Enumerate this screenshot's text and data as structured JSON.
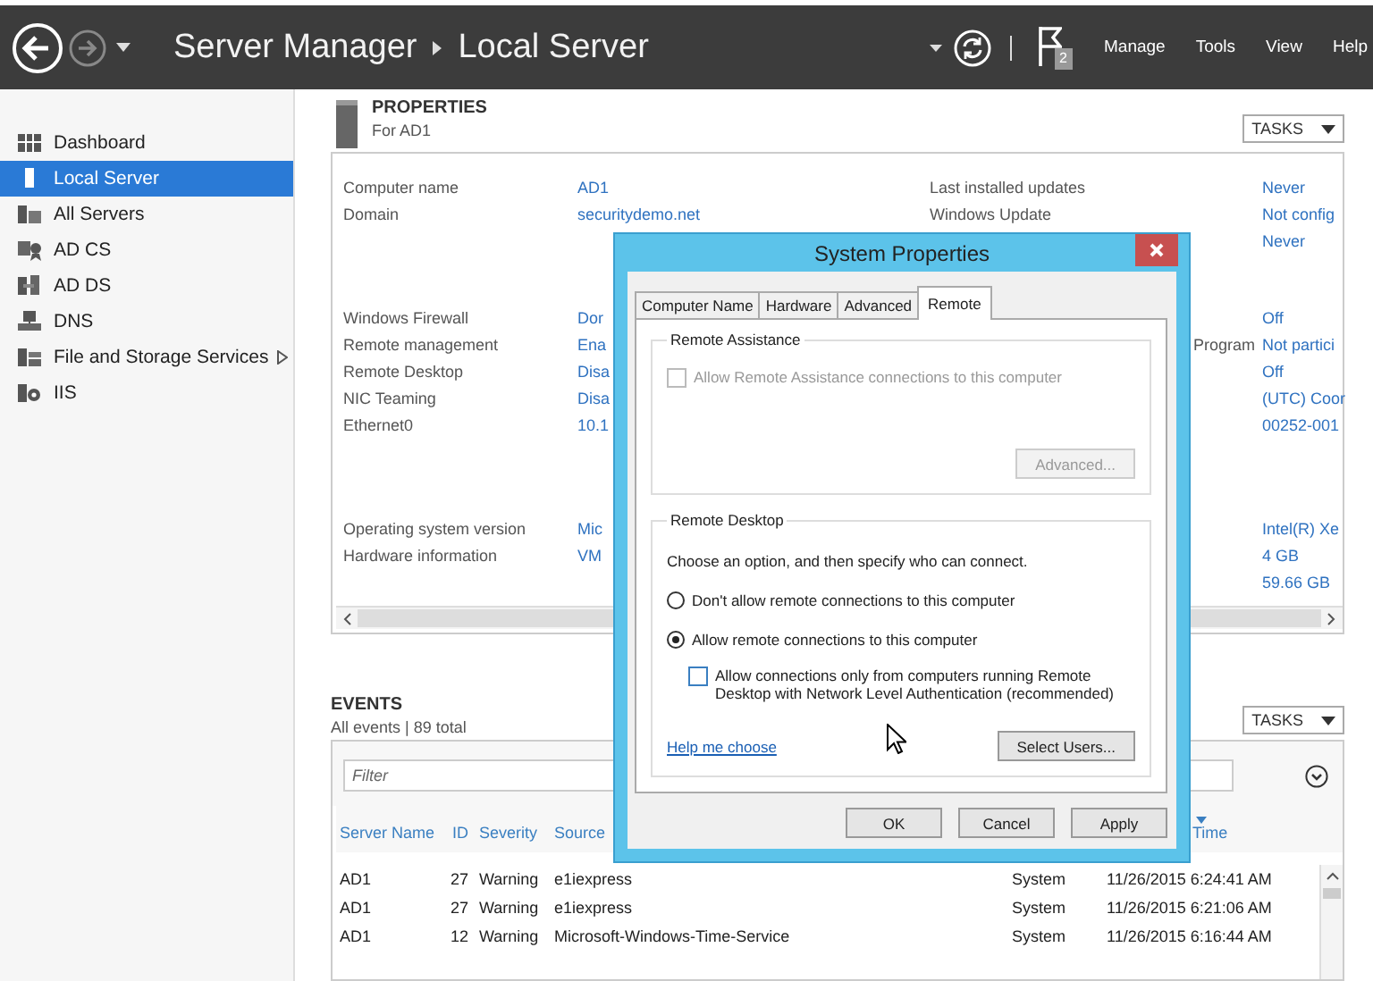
{
  "toolbar": {
    "title": "Server Manager",
    "subtitle": "Local Server",
    "notifications": "2",
    "menu": [
      "Manage",
      "Tools",
      "View",
      "Help"
    ]
  },
  "sidebar": {
    "items": [
      {
        "label": "Dashboard",
        "kind": "dashboard",
        "selected": false,
        "expandable": false
      },
      {
        "label": "Local Server",
        "kind": "server",
        "selected": true,
        "expandable": false
      },
      {
        "label": "All Servers",
        "kind": "servers",
        "selected": false,
        "expandable": false
      },
      {
        "label": "AD CS",
        "kind": "adcs",
        "selected": false,
        "expandable": false
      },
      {
        "label": "AD DS",
        "kind": "adds",
        "selected": false,
        "expandable": false
      },
      {
        "label": "DNS",
        "kind": "dns",
        "selected": false,
        "expandable": false
      },
      {
        "label": "File and Storage Services",
        "kind": "storage",
        "selected": false,
        "expandable": true
      },
      {
        "label": "IIS",
        "kind": "iis",
        "selected": false,
        "expandable": false
      }
    ]
  },
  "properties": {
    "title": "PROPERTIES",
    "subtitle": "For AD1",
    "tasks": "TASKS",
    "groups": [
      [
        {
          "label": "Computer name",
          "value": "AD1",
          "label_2": "Last installed updates",
          "value_2": "Never"
        },
        {
          "label": "Domain",
          "value": "securitydemo.net",
          "label_2": "Windows Update",
          "value_2": "Not config"
        },
        {
          "value_2": "Never"
        }
      ],
      [
        {
          "label": "Windows Firewall",
          "value": "Dor",
          "value_2": "Off"
        },
        {
          "label": "Remote management",
          "value": "Ena",
          "label_2": "Program",
          "label_2_covered": true,
          "value_2": "Not partici"
        },
        {
          "label": "Remote Desktop",
          "value": "Disa",
          "value_2": "Off"
        },
        {
          "label": "NIC Teaming",
          "value": "Disa",
          "value_2": "(UTC) Coor"
        },
        {
          "label": "Ethernet0",
          "value": "10.1",
          "value_2": "00252-001"
        }
      ],
      [
        {
          "label": "Operating system version",
          "value": "Mic",
          "value_2": "Intel(R) Xe"
        },
        {
          "label": "Hardware information",
          "value": "VM",
          "value_2": "4 GB"
        },
        {
          "value_2": "59.66 GB"
        }
      ]
    ]
  },
  "events": {
    "title": "EVENTS",
    "subtitle": "All events | 89 total",
    "tasks": "TASKS",
    "filter_placeholder": "Filter",
    "columns": [
      {
        "label": "Server Name",
        "sorted": false
      },
      {
        "label": "ID",
        "sorted": false
      },
      {
        "label": "Severity",
        "sorted": false
      },
      {
        "label": "Source",
        "sorted": false
      },
      {
        "label": "Time",
        "sorted": true
      }
    ],
    "rows": [
      {
        "server_name": "AD1",
        "id": "27",
        "severity": "Warning",
        "source": "e1iexpress",
        "column_5": "System",
        "time": "11/26/2015 6:24:41 AM"
      },
      {
        "server_name": "AD1",
        "id": "27",
        "severity": "Warning",
        "source": "e1iexpress",
        "column_5": "System",
        "time": "11/26/2015 6:21:06 AM"
      },
      {
        "server_name": "AD1",
        "id": "12",
        "severity": "Warning",
        "source": "Microsoft-Windows-Time-Service",
        "column_5": "System",
        "time": "11/26/2015 6:16:44 AM"
      }
    ]
  },
  "dialog": {
    "title": "System Properties",
    "tabs": [
      {
        "label": "Computer Name",
        "selected": false
      },
      {
        "label": "Hardware",
        "selected": false
      },
      {
        "label": "Advanced",
        "selected": false
      },
      {
        "label": "Remote",
        "selected": true
      }
    ],
    "remote_assistance": {
      "title": "Remote Assistance",
      "checkbox": {
        "label": "Allow Remote Assistance connections to this computer",
        "checked": false,
        "disabled": true
      },
      "button": {
        "label": "Advanced...",
        "disabled": true
      }
    },
    "remote_desktop": {
      "title": "Remote Desktop",
      "instruction": "Choose an option, and then specify who can connect.",
      "options": [
        {
          "label": "Don't allow remote connections to this computer",
          "selected": false
        },
        {
          "label": "Allow remote connections to this computer",
          "selected": true
        }
      ],
      "checkbox": {
        "label": "Allow connections only from computers running Remote Desktop with Network Level Authentication (recommended)",
        "checked": false,
        "disabled": false
      },
      "help_link": "Help me choose",
      "button": {
        "label": "Select Users...",
        "disabled": false
      }
    },
    "buttons": [
      "OK",
      "Cancel",
      "Apply"
    ]
  }
}
